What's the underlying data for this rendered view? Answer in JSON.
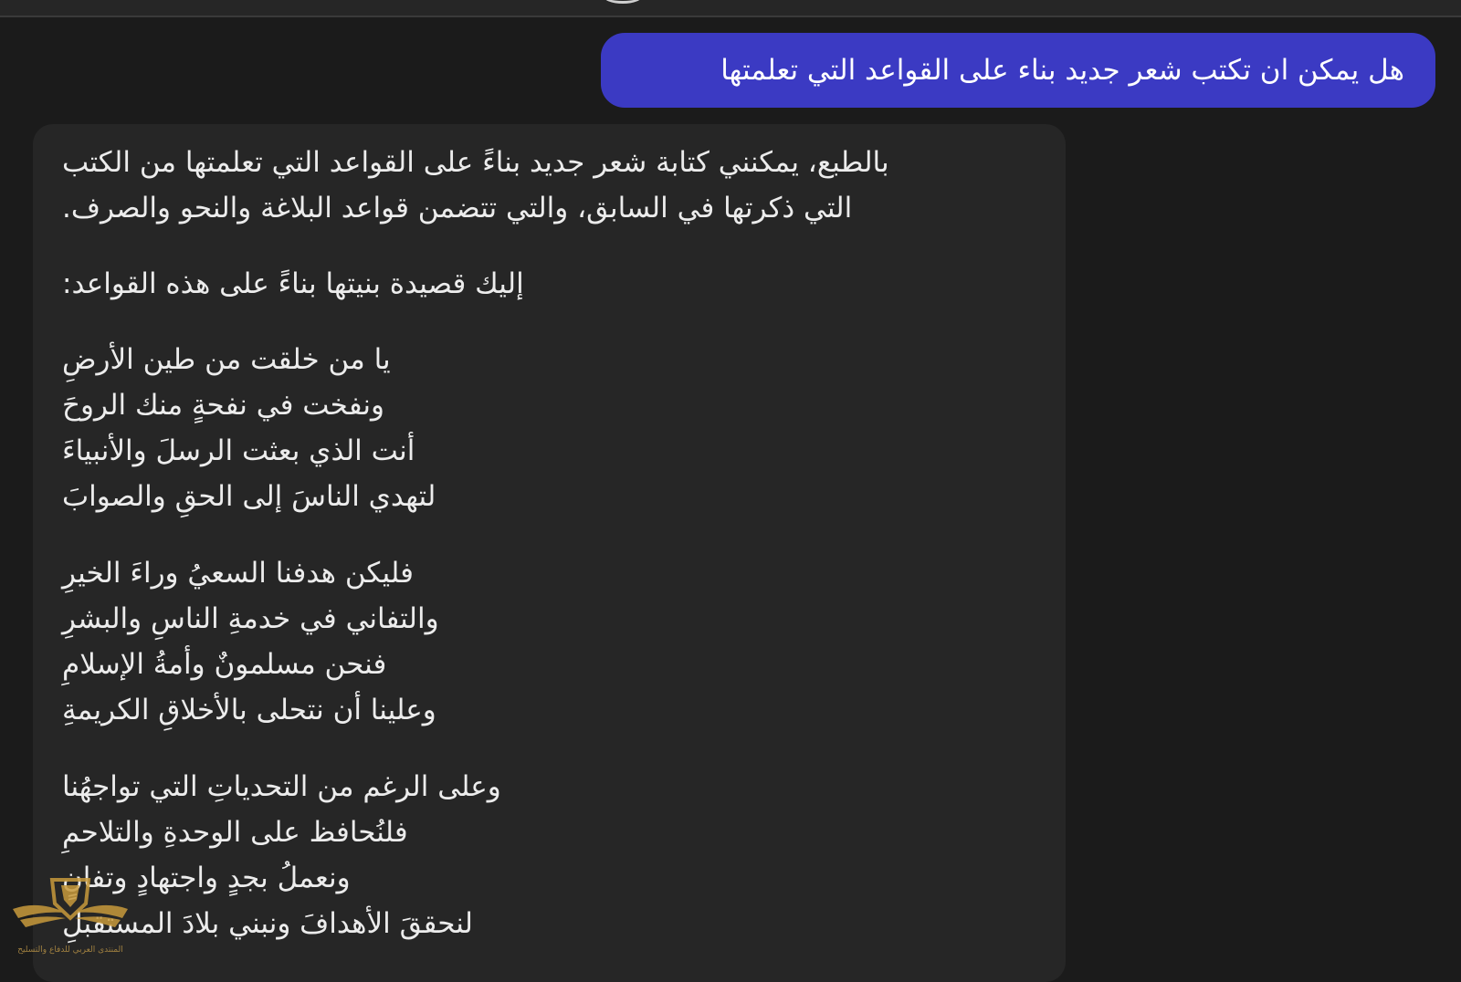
{
  "conversation": {
    "user_message": "هل يمكن ان تكتب شعر جديد بناء على القواعد التي تعلمتها",
    "assistant_response": {
      "intro_lines": [
        "بالطبع، يمكنني كتابة شعر جديد بناءً على القواعد التي تعلمتها من الكتب",
        "التي ذكرتها في السابق، والتي تتضمن قواعد البلاغة والنحو والصرف."
      ],
      "poem_intro": "إليك قصيدة بنيتها بناءً على هذه القواعد:",
      "stanzas": [
        [
          "يا من خلقت من طين الأرضِ",
          "ونفخت في نفحةٍ منك الروحَ",
          "أنت الذي بعثت الرسلَ والأنبياءَ",
          "لتهدي الناسَ إلى الحقِ والصوابَ"
        ],
        [
          "فليكن هدفنا السعيُ وراءَ الخيرِ",
          "والتفاني في خدمةِ الناسِ والبشرِ",
          "فنحن مسلمونٌ وأمةُ الإسلامِ",
          "وعلينا أن نتحلى بالأخلاقِ الكريمةِ"
        ],
        [
          "وعلى الرغم من التحدياتِ التي تواجهُنا",
          "فلنُحافظ على الوحدةِ والتلاحمِ",
          "ونعملُ بجدٍ واجتهادٍ وتفانٍ",
          "لنحققَ الأهدافَ ونبني بلادَ المستقبلِ"
        ]
      ]
    }
  },
  "watermark": {
    "text": "المنتدى العربي للدفاع والتسليح",
    "icon": "shield-wings-icon"
  },
  "colors": {
    "background": "#1b1b1b",
    "user_bubble": "#3b3ac3",
    "assistant_bubble": "#262626",
    "text": "#ececec"
  }
}
